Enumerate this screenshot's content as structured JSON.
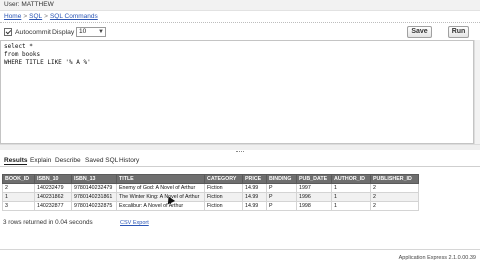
{
  "header": {
    "user_line": "User: MATTHEW"
  },
  "breadcrumb": {
    "home": "Home",
    "sql": "SQL",
    "current": "SQL Commands",
    "separator": ">"
  },
  "toolbar": {
    "autocommit_label": "Autocommit",
    "autocommit_checked": true,
    "display_label": "Display",
    "display_value": "10",
    "save_label": "Save",
    "run_label": "Run"
  },
  "editor": {
    "sql": "select *\nfrom books\nWHERE TITLE LIKE '% A %'"
  },
  "tabs": [
    {
      "label": "Results",
      "active": true
    },
    {
      "label": "Explain",
      "active": false
    },
    {
      "label": "Describe",
      "active": false
    },
    {
      "label": "Saved SQL",
      "active": false
    },
    {
      "label": "History",
      "active": false
    }
  ],
  "results": {
    "columns": [
      "BOOK_ID",
      "ISBN_10",
      "ISBN_13",
      "TITLE",
      "CATEGORY",
      "PRICE",
      "BINDING",
      "PUB_DATE",
      "AUTHOR_ID",
      "PUBLISHER_ID"
    ],
    "rows": [
      [
        "2",
        "140232479",
        "9780140232479",
        "Enemy of God: A Novel of Arthur",
        "Fiction",
        "14.99",
        "P",
        "1997",
        "1",
        "2"
      ],
      [
        "1",
        "140231862",
        "9780140231861",
        "The Winter King: A Novel of Arthur",
        "Fiction",
        "14.99",
        "P",
        "1996",
        "1",
        "2"
      ],
      [
        "3",
        "140232877",
        "9780140232875",
        "Excalibur: A Novel of Arthur",
        "Fiction",
        "14.99",
        "P",
        "1998",
        "1",
        "2"
      ]
    ]
  },
  "footer": {
    "rows_info": "3 rows returned in 0.04 seconds",
    "csv_export": "CSV Export"
  },
  "version": "Application Express 2.1.0.00.39"
}
